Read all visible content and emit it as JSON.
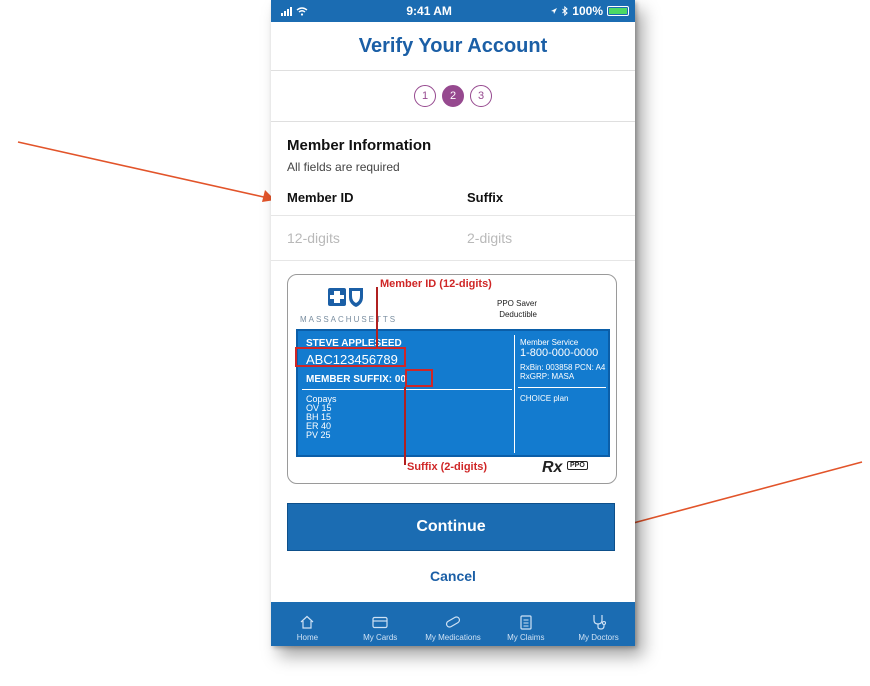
{
  "status_bar": {
    "time": "9:41 AM",
    "battery": "100%"
  },
  "header": {
    "title": "Verify Your Account"
  },
  "steps": [
    {
      "label": "1",
      "active": false
    },
    {
      "label": "2",
      "active": true
    },
    {
      "label": "3",
      "active": false
    }
  ],
  "form": {
    "section_title": "Member Information",
    "subtitle": "All fields are required",
    "member_id_label": "Member ID",
    "suffix_label": "Suffix",
    "member_id_placeholder": "12-digits",
    "suffix_placeholder": "2-digits"
  },
  "card": {
    "brand": "MASSACHUSETTS",
    "plan_name": "PPO Saver",
    "plan_sub": "Deductible",
    "member_name": "STEVE APPLESEED",
    "member_id": "ABC123456789",
    "member_suffix_label": "MEMBER SUFFIX: 00",
    "copays_title": "Copays",
    "copays": [
      "OV 15",
      "BH 15",
      "ER 40",
      "PV 25"
    ],
    "member_service_label": "Member Service",
    "member_service_phone": "1-800-000-0000",
    "rxbin": "RxBin: 003858 PCN: A4",
    "rxgrp": "RxGRP: MASA",
    "choice": "CHOICE plan",
    "callout_member_id": "Member ID (12-digits)",
    "callout_suffix": "Suffix (2-digits)",
    "rx_symbol": "Rx",
    "ppo_badge": "PPO"
  },
  "actions": {
    "continue_label": "Continue",
    "cancel_label": "Cancel"
  },
  "tab_bar": {
    "items": [
      {
        "label": "Home",
        "icon": "home-icon"
      },
      {
        "label": "My Cards",
        "icon": "card-icon"
      },
      {
        "label": "My Medications",
        "icon": "pill-icon"
      },
      {
        "label": "My Claims",
        "icon": "clipboard-icon"
      },
      {
        "label": "My Doctors",
        "icon": "stethoscope-icon"
      }
    ]
  },
  "colors": {
    "brand_blue": "#1b6cb2",
    "step_purple": "#96498f",
    "card_blue": "#137bcf",
    "callout_red": "#cf2626",
    "arrow_orange": "#e2542a"
  }
}
